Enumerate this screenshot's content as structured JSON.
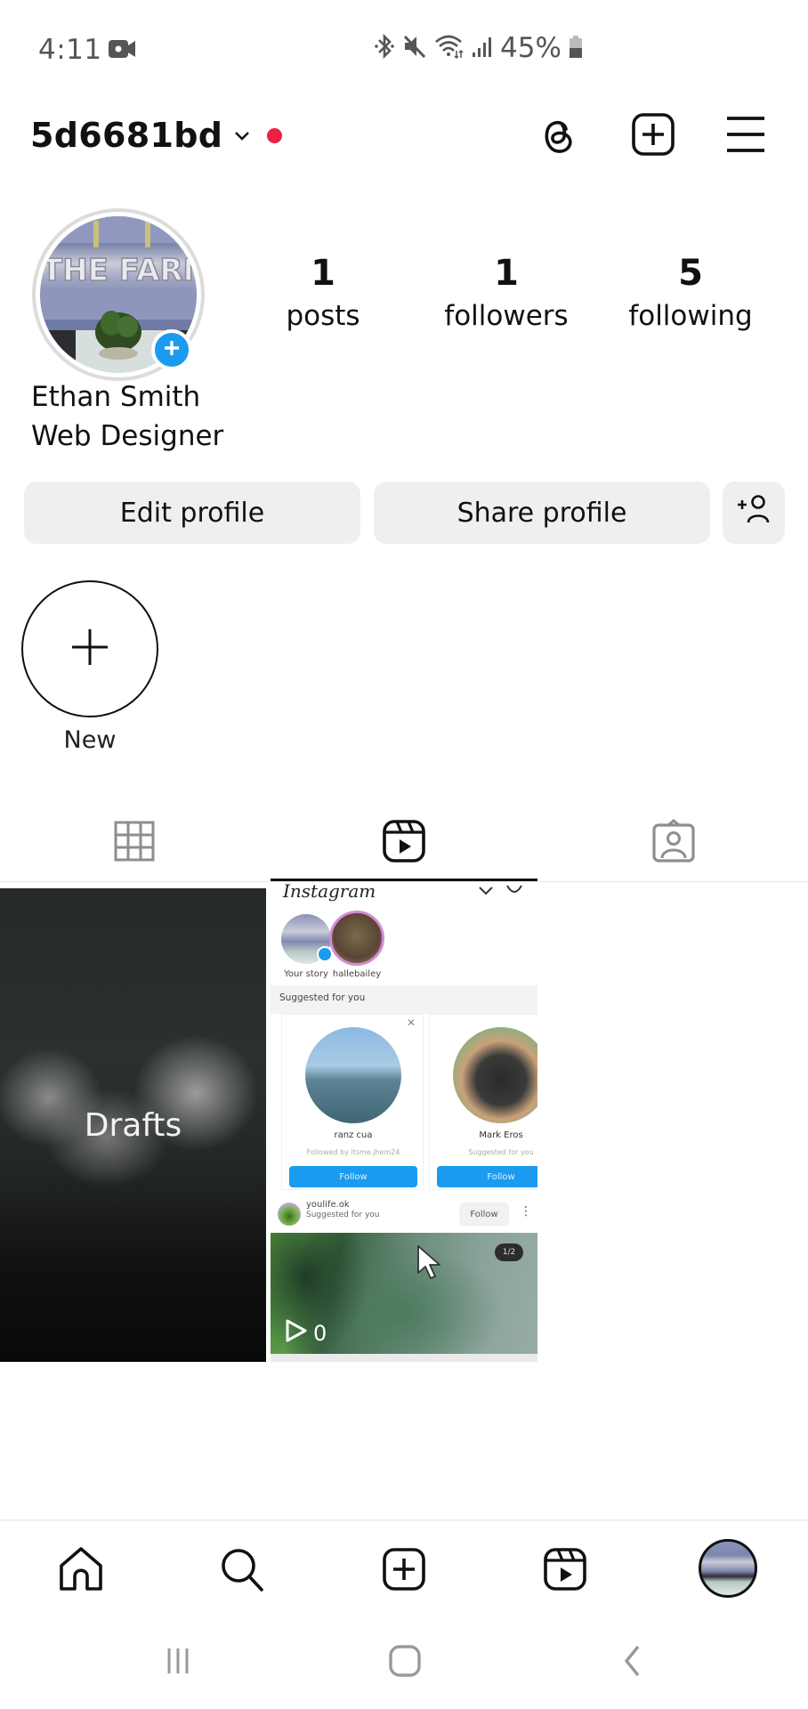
{
  "status_bar": {
    "time": "4:11",
    "battery_percent": "45%",
    "icons": [
      "screen-record-icon",
      "bluetooth-icon",
      "mute-icon",
      "wifi-icon",
      "signal-icon",
      "battery-icon"
    ]
  },
  "header": {
    "username": "5d6681bd",
    "has_notification_dot": true,
    "notification_color": "#ed1f45",
    "icons": [
      "threads-icon",
      "create-icon",
      "menu-icon"
    ]
  },
  "profile": {
    "display_name": "Ethan Smith",
    "bio": "Web Designer",
    "avatar_alt": "THE FARM sign with potted plant",
    "stats": [
      {
        "value": "1",
        "label": "posts"
      },
      {
        "value": "1",
        "label": "followers"
      },
      {
        "value": "5",
        "label": "following"
      }
    ]
  },
  "actions": {
    "edit_profile": "Edit profile",
    "share_profile": "Share profile",
    "discover_people_icon": "add-person-icon"
  },
  "highlights": [
    {
      "label": "New",
      "icon": "plus-icon"
    }
  ],
  "tabs": [
    {
      "name": "posts-grid",
      "icon": "grid-icon",
      "active": false
    },
    {
      "name": "reels",
      "icon": "reels-icon",
      "active": true
    },
    {
      "name": "tagged",
      "icon": "tagged-icon",
      "active": false
    }
  ],
  "grid": {
    "drafts_label": "Drafts",
    "reel": {
      "app_logo": "Instagram",
      "stories": [
        {
          "label": "Your story"
        },
        {
          "label": "hallebailey"
        }
      ],
      "suggested_header": "Suggested for you",
      "suggestions": [
        {
          "name": "ranz cua",
          "subtitle": "Followed by itsme.jhem24",
          "button": "Follow"
        },
        {
          "name": "Mark Eros",
          "subtitle": "Suggested for you",
          "button": "Follow"
        }
      ],
      "post": {
        "username": "youlife.ok",
        "subtitle": "Suggested for you",
        "follow_label": "Follow",
        "more": "⋮",
        "page_indicator": "1/2"
      },
      "play_count": "0"
    }
  },
  "bottom_nav": [
    {
      "name": "home",
      "icon": "home-icon"
    },
    {
      "name": "search",
      "icon": "search-icon"
    },
    {
      "name": "create",
      "icon": "create-icon"
    },
    {
      "name": "reels",
      "icon": "reels-icon"
    },
    {
      "name": "profile",
      "icon": "profile-avatar"
    }
  ],
  "system_nav": [
    "recent-apps-icon",
    "home-button-icon",
    "back-icon"
  ],
  "colors": {
    "accent_blue": "#1a9bf0",
    "button_gray": "#efefef",
    "text": "#111111"
  }
}
